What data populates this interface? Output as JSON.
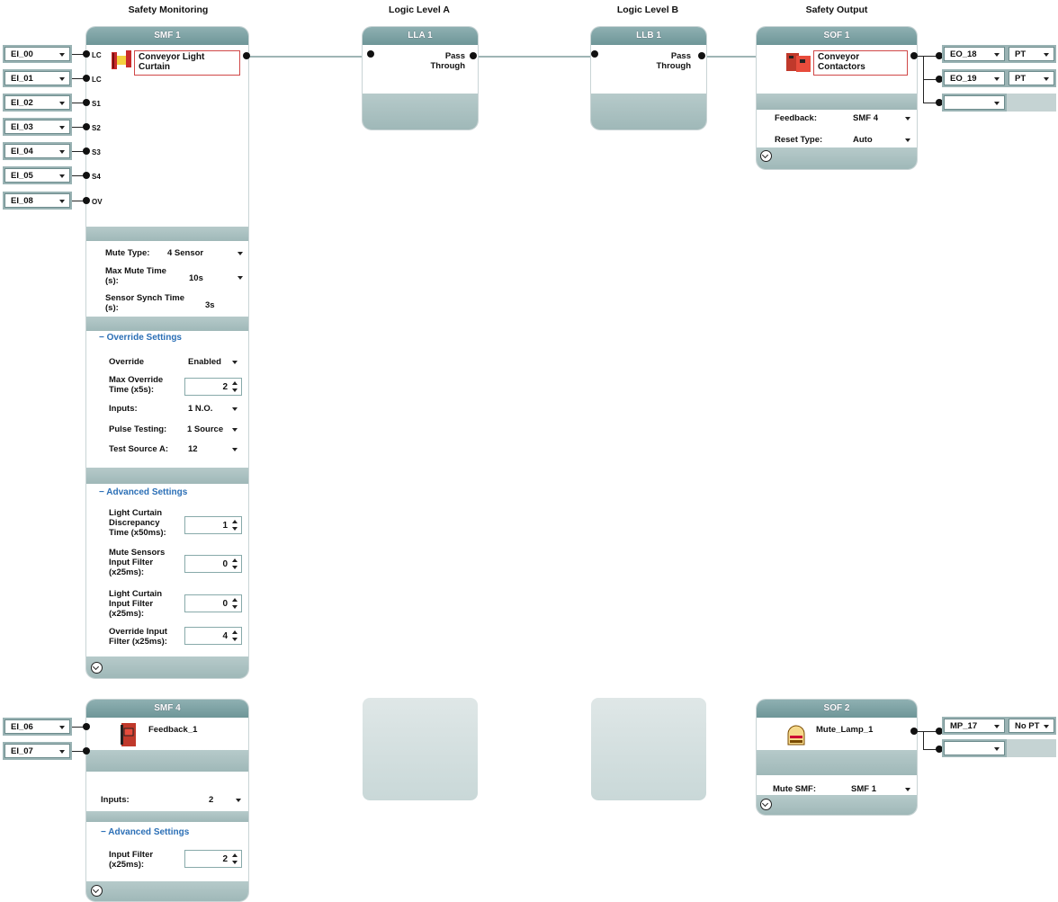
{
  "columns": {
    "safety_monitoring": "Safety Monitoring",
    "logic_a": "Logic Level A",
    "logic_b": "Logic Level B",
    "safety_output": "Safety Output"
  },
  "inputs_top": [
    {
      "id": "EI_00",
      "port": "LC"
    },
    {
      "id": "EI_01",
      "port": "LC"
    },
    {
      "id": "EI_02",
      "port": "S1"
    },
    {
      "id": "EI_03",
      "port": "S2"
    },
    {
      "id": "EI_04",
      "port": "S3"
    },
    {
      "id": "EI_05",
      "port": "S4"
    },
    {
      "id": "EI_08",
      "port": "OV"
    }
  ],
  "smf1": {
    "title": "SMF 1",
    "device": "Conveyor Light Curtain",
    "mute_type_label": "Mute Type:",
    "mute_type_value": "4 Sensor",
    "max_mute_label": "Max Mute Time (s):",
    "max_mute_value": "10s",
    "synch_label": "Sensor Synch Time (s):",
    "synch_value": "3s",
    "override_section": "Override Settings",
    "override_label": "Override",
    "override_value": "Enabled",
    "max_override_label": "Max Override Time (x5s):",
    "max_override_value": "2",
    "inputs_label": "Inputs:",
    "inputs_value": "1 N.O.",
    "pulse_label": "Pulse Testing:",
    "pulse_value": "1 Source",
    "test_src_label": "Test Source A:",
    "test_src_value": "12",
    "advanced_section": "Advanced Settings",
    "lc_disc_label": "Light Curtain Discrepancy Time (x50ms):",
    "lc_disc_value": "1",
    "mute_filter_label": "Mute Sensors Input Filter (x25ms):",
    "mute_filter_value": "0",
    "lc_filter_label": "Light Curtain Input Filter (x25ms):",
    "lc_filter_value": "0",
    "ov_filter_label": "Override Input Filter (x25ms):",
    "ov_filter_value": "4"
  },
  "lla1": {
    "title": "LLA 1",
    "text": "Pass Through"
  },
  "llb1": {
    "title": "LLB 1",
    "text": "Pass Through"
  },
  "sof1": {
    "title": "SOF 1",
    "device": "Conveyor Contactors",
    "feedback_label": "Feedback:",
    "feedback_value": "SMF 4",
    "reset_label": "Reset Type:",
    "reset_value": "Auto"
  },
  "outputs_top": [
    {
      "id": "EO_18",
      "mode": "PT"
    },
    {
      "id": "EO_19",
      "mode": "PT"
    },
    {
      "id": "",
      "mode": ""
    }
  ],
  "inputs_bottom": [
    {
      "id": "EI_06"
    },
    {
      "id": "EI_07"
    }
  ],
  "smf4": {
    "title": "SMF 4",
    "device": "Feedback_1",
    "inputs_label": "Inputs:",
    "inputs_value": "2",
    "advanced_section": "Advanced Settings",
    "filter_label": "Input Filter (x25ms):",
    "filter_value": "2"
  },
  "sof2": {
    "title": "SOF 2",
    "device": "Mute_Lamp_1",
    "mute_smf_label": "Mute SMF:",
    "mute_smf_value": "SMF 1"
  },
  "outputs_bottom": [
    {
      "id": "MP_17",
      "mode": "No PT"
    },
    {
      "id": "",
      "mode": ""
    }
  ],
  "colors": {
    "header": "#7aa0a2",
    "device_border": "#d04848",
    "section_link": "#2b6fb6",
    "wire": "#9fb5b5"
  }
}
